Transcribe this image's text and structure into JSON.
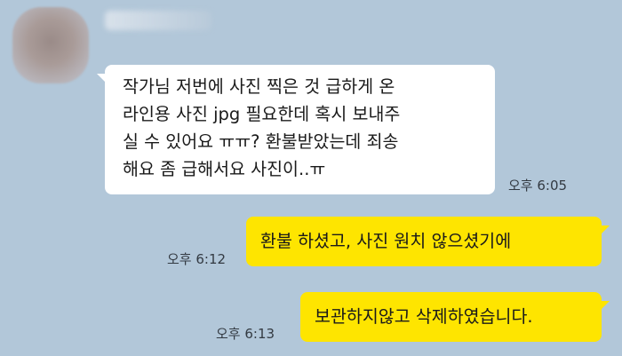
{
  "chat": {
    "sender_name": "",
    "messages": [
      {
        "direction": "incoming",
        "lines": [
          "작가님 저번에 사진 찍은 것 급하게 온",
          "라인용 사진 jpg 필요한데 혹시 보내주",
          "실 수 있어요 ㅠㅠ? 환불받았는데 죄송",
          "해요 좀 급해서요 사진이..ㅠ"
        ],
        "time": "오후 6:05"
      },
      {
        "direction": "outgoing",
        "text": "환불 하셨고, 사진 원치 않으셨기에",
        "time": "오후 6:12"
      },
      {
        "direction": "outgoing",
        "text": "보관하지않고 삭제하였습니다.",
        "time": "오후 6:13"
      }
    ]
  },
  "colors": {
    "background": "#b2c7d9",
    "incoming_bubble": "#ffffff",
    "outgoing_bubble": "#fee500"
  }
}
